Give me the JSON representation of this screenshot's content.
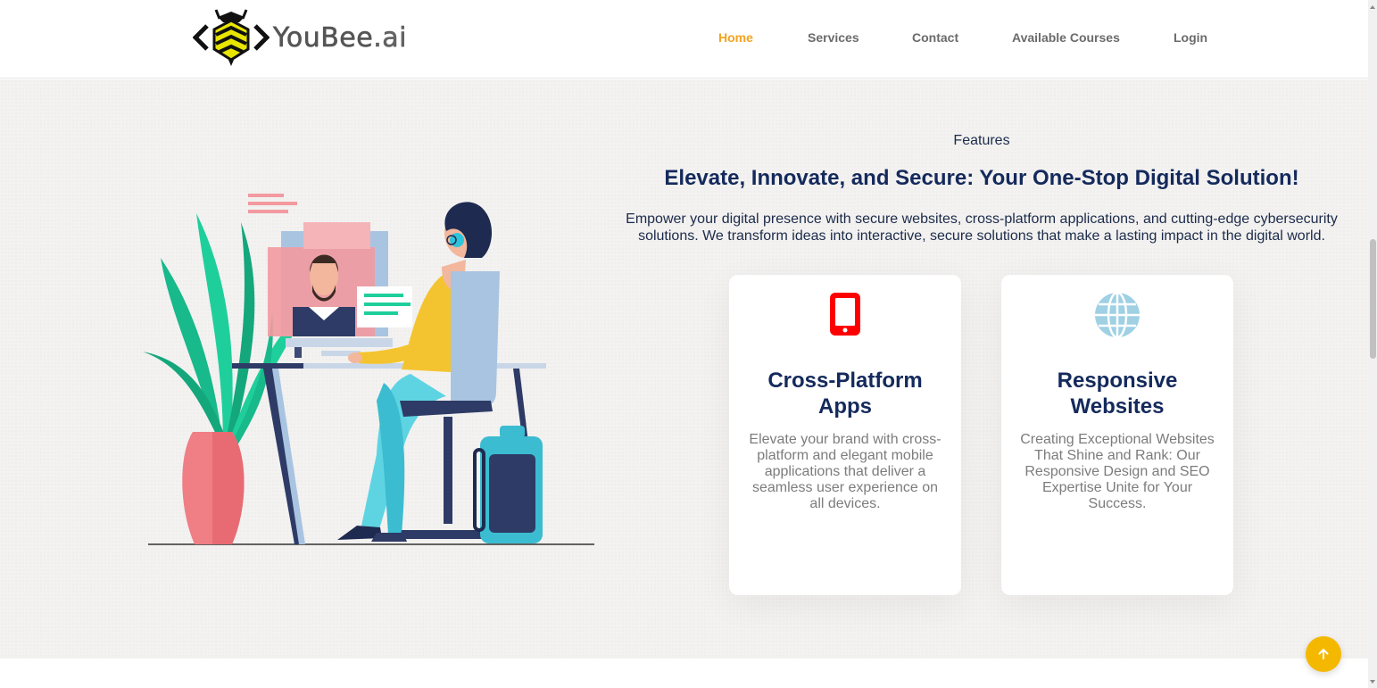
{
  "brand": {
    "logo_text": "YouBee",
    "logo_suffix": ".ai"
  },
  "nav": {
    "items": [
      {
        "label": "Home",
        "active": true
      },
      {
        "label": "Services",
        "active": false
      },
      {
        "label": "Contact",
        "active": false
      },
      {
        "label": "Available Courses",
        "active": false
      },
      {
        "label": "Login",
        "active": false
      }
    ]
  },
  "features": {
    "kicker": "Features",
    "headline": "Elevate, Innovate, and Secure: Your One-Stop Digital Solution!",
    "lead": "Empower your digital presence with secure websites, cross-platform applications, and cutting-edge cybersecurity solutions. We transform ideas into interactive, secure solutions that make a lasting impact in the digital world.",
    "cards": [
      {
        "icon": "mobile-phone-icon",
        "title": "Cross-Platform Apps",
        "text": "Elevate your brand with cross-platform and elegant mobile applications that deliver a seamless user experience on all devices."
      },
      {
        "icon": "globe-icon",
        "title": "Responsive Websites",
        "text": "Creating Exceptional Websites That Shine and Rank: Our Responsive Design and SEO Expertise Unite for Your Success."
      }
    ]
  },
  "colors": {
    "accent": "#f4a320",
    "heading": "#142a5c",
    "phone_icon": "#ff0000",
    "globe_icon": "#9fd0e4",
    "back_to_top": "#f5b800"
  },
  "icons": {
    "back_to_top": "arrow-up-icon",
    "scrollbar_up": "triangle-up-icon",
    "scrollbar_down": "triangle-down-icon"
  }
}
